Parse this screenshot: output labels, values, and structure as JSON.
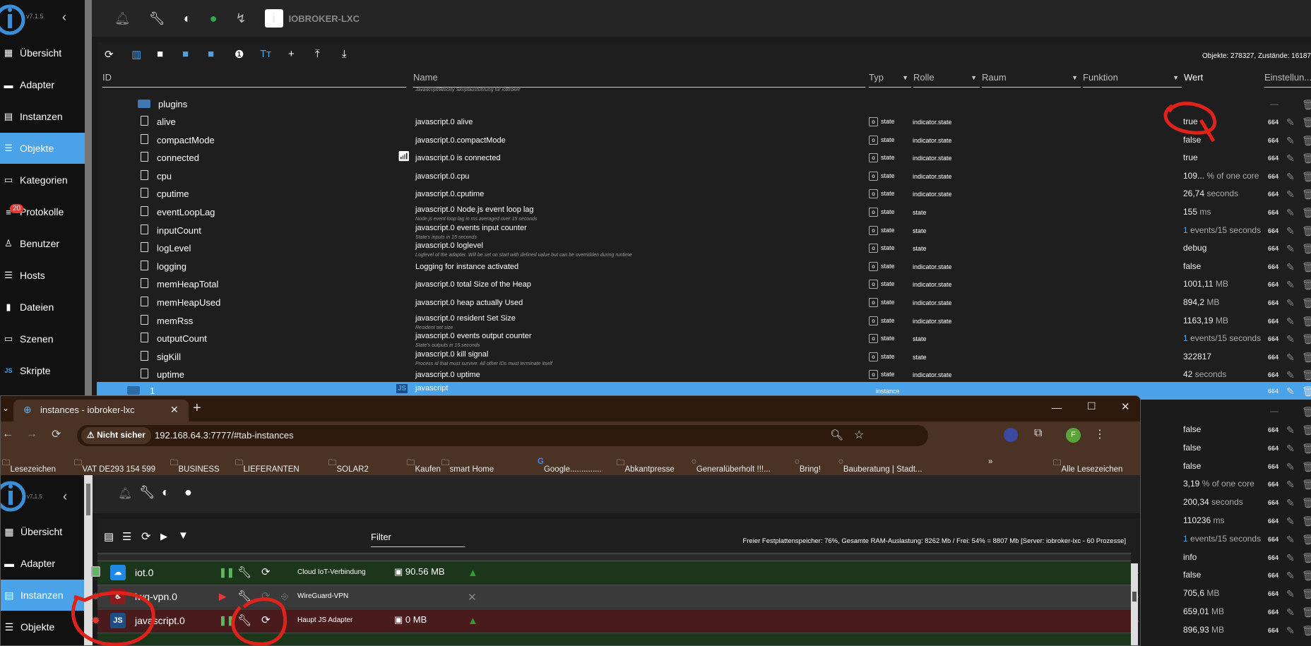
{
  "app": {
    "version": "v7.1.5",
    "host": "IOBROKER-LXC"
  },
  "sidebar": {
    "items": [
      {
        "label": "Übersicht",
        "icon": "grid-icon"
      },
      {
        "label": "Adapter",
        "icon": "store-icon"
      },
      {
        "label": "Instanzen",
        "icon": "instances-icon"
      },
      {
        "label": "Objekte",
        "icon": "list-icon",
        "active": true
      },
      {
        "label": "Kategorien",
        "icon": "categories-icon"
      },
      {
        "label": "Protokolle",
        "icon": "log-icon",
        "badge": "20"
      },
      {
        "label": "Benutzer",
        "icon": "user-icon"
      },
      {
        "label": "Hosts",
        "icon": "hosts-icon"
      },
      {
        "label": "Dateien",
        "icon": "files-icon"
      },
      {
        "label": "Szenen",
        "icon": "scenes-icon"
      },
      {
        "label": "Skripte",
        "icon": "js-icon"
      }
    ]
  },
  "objects": {
    "counts": "Objekte: 278327, Zustände: 16187",
    "columns": {
      "id": "ID",
      "name": "Name",
      "type": "Typ",
      "role": "Rolle",
      "room": "Raum",
      "function": "Funktion",
      "value": "Wert",
      "settings": "Einstellun..."
    },
    "cut_desc": "Javascript/Blockly Skriptausführung für ioBroker",
    "folder": "plugins",
    "dash": "—",
    "rows": [
      {
        "id": "alive",
        "name": "javascript.0 alive",
        "desc": "",
        "type": "state",
        "role": "indicator.state",
        "value": "true",
        "unit": "",
        "acl": "664"
      },
      {
        "id": "compactMode",
        "name": "javascript.0.compactMode",
        "desc": "",
        "type": "state",
        "role": "indicator.state",
        "value": "false",
        "unit": "",
        "acl": "664"
      },
      {
        "id": "connected",
        "name": "javascript.0 is connected",
        "desc": "",
        "type": "state",
        "role": "indicator.state",
        "value": "true",
        "unit": "",
        "acl": "664",
        "wifi": true
      },
      {
        "id": "cpu",
        "name": "javascript.0.cpu",
        "desc": "",
        "type": "state",
        "role": "indicator.state",
        "value": "109...",
        "unit": "% of one core",
        "acl": "664"
      },
      {
        "id": "cputime",
        "name": "javascript.0.cputime",
        "desc": "",
        "type": "state",
        "role": "indicator.state",
        "value": "26,74",
        "unit": "seconds",
        "acl": "664"
      },
      {
        "id": "eventLoopLag",
        "name": "javascript.0 Node.js event loop lag",
        "desc": "Node.js event loop lag in ms averaged over 15 seconds",
        "type": "state",
        "role": "state",
        "value": "155",
        "unit": "ms",
        "acl": "664"
      },
      {
        "id": "inputCount",
        "name": "javascript.0 events input counter",
        "desc": "State's inputs in 15 seconds",
        "type": "state",
        "role": "state",
        "value": "1",
        "unit": "events/15 seconds",
        "acl": "664"
      },
      {
        "id": "logLevel",
        "name": "javascript.0 loglevel",
        "desc": "Loglevel of the adapter. Will be set on start with defined value but can be overridden during runtime",
        "type": "state",
        "role": "state",
        "value": "debug",
        "unit": "",
        "acl": "664"
      },
      {
        "id": "logging",
        "name": "Logging for instance activated",
        "desc": "",
        "type": "state",
        "role": "indicator.state",
        "value": "false",
        "unit": "",
        "acl": "664"
      },
      {
        "id": "memHeapTotal",
        "name": "javascript.0 total Size of the Heap",
        "desc": "",
        "type": "state",
        "role": "indicator.state",
        "value": "1001,11",
        "unit": "MB",
        "acl": "664"
      },
      {
        "id": "memHeapUsed",
        "name": "javascript.0 heap actually Used",
        "desc": "",
        "type": "state",
        "role": "indicator.state",
        "value": "894,2",
        "unit": "MB",
        "acl": "664"
      },
      {
        "id": "memRss",
        "name": "javascript.0 resident Set Size",
        "desc": "Resident set size",
        "type": "state",
        "role": "indicator.state",
        "value": "1163,19",
        "unit": "MB",
        "acl": "664"
      },
      {
        "id": "outputCount",
        "name": "javascript.0 events output counter",
        "desc": "State's outputs in 15 seconds",
        "type": "state",
        "role": "state",
        "value": "1",
        "unit": "events/15 seconds",
        "acl": "664"
      },
      {
        "id": "sigKill",
        "name": "javascript.0 kill signal",
        "desc": "Process id that must survive. All other IDs must terminate itself",
        "type": "state",
        "role": "state",
        "value": "322817",
        "unit": "",
        "acl": "664"
      },
      {
        "id": "uptime",
        "name": "javascript.0 uptime",
        "desc": "",
        "type": "state",
        "role": "indicator.state",
        "value": "42",
        "unit": "seconds",
        "acl": "664"
      }
    ],
    "selected": {
      "id": "1",
      "name": "javascript",
      "type": "instance",
      "acl": "664"
    },
    "lower_rows": [
      {
        "value": "false",
        "unit": "",
        "acl": "664"
      },
      {
        "value": "false",
        "unit": "",
        "acl": "664"
      },
      {
        "value": "false",
        "unit": "",
        "acl": "664"
      },
      {
        "value": "3,19",
        "unit": "% of one core",
        "acl": "664"
      },
      {
        "value": "200,34",
        "unit": "seconds",
        "acl": "664"
      },
      {
        "value": "110236",
        "unit": "ms",
        "acl": "664"
      },
      {
        "value": "1",
        "unit": "events/15 seconds",
        "acl": "664"
      },
      {
        "value": "info",
        "unit": "",
        "acl": "664"
      },
      {
        "value": "false",
        "unit": "",
        "acl": "664"
      },
      {
        "value": "705,6",
        "unit": "MB",
        "acl": "664"
      },
      {
        "value": "659,01",
        "unit": "MB",
        "acl": "664"
      },
      {
        "value": "896,93",
        "unit": "MB",
        "acl": "664"
      }
    ]
  },
  "browser": {
    "tab_title": "instances - iobroker-lxc",
    "security": "Nicht sicher",
    "url": "192.168.64.3:7777/#tab-instances",
    "profile_initial": "F",
    "bookmarks": [
      "Lesezeichen",
      "VAT DE293 154 599",
      "BUSINESS",
      "LIEFERANTEN",
      "SOLAR2",
      "Kaufen",
      "smart Home",
      "Google..............",
      "Abkantpresse",
      "Generalüberholt !!!...",
      "Bring!",
      "Bauberatung | Stadt..."
    ],
    "all_bookmarks": "Alle Lesezeichen",
    "more": "»"
  },
  "instances": {
    "sidebar": [
      {
        "label": "Übersicht"
      },
      {
        "label": "Adapter"
      },
      {
        "label": "Instanzen",
        "active": true
      },
      {
        "label": "Objekte"
      }
    ],
    "filter_label": "Filter",
    "system_info": "Freier Festplattenspeicher: 76%, Gesamte RAM-Auslastung: 8262 Mb / Frei: 54% = 8807 Mb [Server: iobroker-lxc - 60 Prozesse]",
    "rows": [
      {
        "name": "iot.0",
        "title": "Cloud IoT-Verbindung",
        "memory": "90.56 MB",
        "status": "running",
        "color": "#1c361c"
      },
      {
        "name": "iwg-vpn.0",
        "title": "WireGuard-VPN",
        "memory": "",
        "status": "stopped",
        "color": "#3a3a3a"
      },
      {
        "name": "javascript.0",
        "title": "Haupt JS Adapter",
        "memory": "0 MB",
        "status": "error",
        "color": "#4a1b1d"
      }
    ]
  },
  "colors": {
    "accent": "#4aa3e8",
    "annotation": "#e0231a",
    "running": "#1c361c",
    "error": "#4a1b1d"
  }
}
